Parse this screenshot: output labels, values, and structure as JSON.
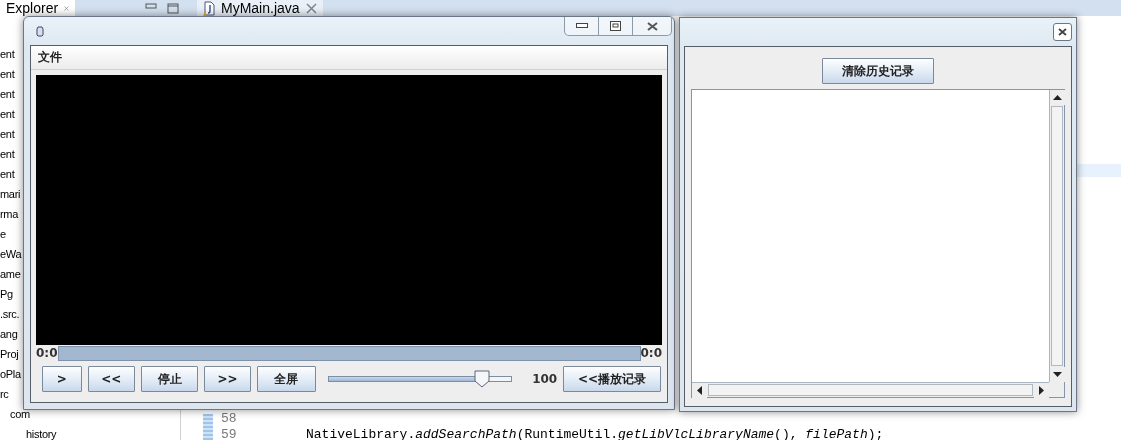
{
  "ide": {
    "explorer_tab": {
      "label": "Explorer",
      "selected": false
    },
    "editor_tab": {
      "label": "MyMain.java",
      "selected": true
    },
    "tree_items": [
      "ent",
      "ent",
      "ent",
      "ent",
      "ent",
      "ent",
      "ent",
      "mari",
      "rma",
      "e",
      "eWa",
      "ame",
      "Pg",
      ".src.",
      "ang",
      "Proj",
      "oPla",
      "rc",
      "com",
      "history"
    ],
    "code_lines": [
      {
        "number": "58"
      },
      {
        "number": "59",
        "code": "NativeLibrary.*addSearchPath*(RuntimeUtil.*getLibVlcLibraryName*(), *filePath*);"
      }
    ]
  },
  "player_window": {
    "menu": [
      "文件"
    ],
    "time_elapsed": "0:0",
    "time_total": "0:0",
    "progress": {
      "level": 0
    },
    "buttons": [
      ">",
      "<<",
      "停止",
      ">>",
      "全屏"
    ],
    "volume": {
      "level": 0.84
    },
    "volume_reading": "100",
    "history_button": "<<播放记录"
  },
  "history_window": {
    "clear_button": "清除历史记录"
  }
}
